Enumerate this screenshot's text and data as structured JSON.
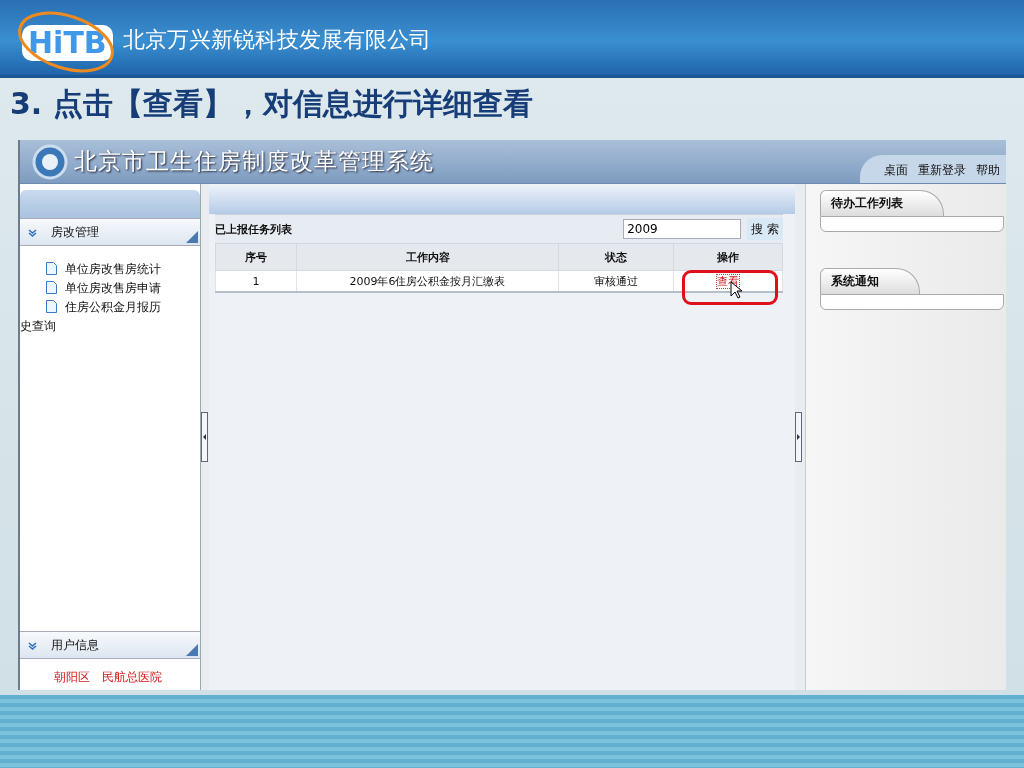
{
  "company": {
    "logo": "HiTB",
    "name": "北京万兴新锐科技发展有限公司"
  },
  "slide_title": "3. 点击【查看】，对信息进行详细查看",
  "app": {
    "title": "北京市卫生住房制度改革管理系统",
    "nav_links": [
      "桌面",
      "重新登录",
      "帮助"
    ]
  },
  "sidebar": {
    "sections": [
      {
        "title": "房改管理",
        "expanded": true,
        "items": [
          "单位房改售房统计",
          "单位房改售房申请",
          "住房公积金月报历史查询"
        ]
      },
      {
        "title": "用户信息",
        "expanded": true,
        "info": [
          "朝阳区",
          "民航总医院"
        ]
      }
    ]
  },
  "task_list": {
    "title": "已上报任务列表",
    "search_value": "2009",
    "search_button": "搜 索",
    "columns": [
      "序号",
      "工作内容",
      "状态",
      "操作"
    ],
    "rows": [
      {
        "index": "1",
        "content": "2009年6住房公积金按月汇缴表",
        "status": "审核通过",
        "action": "查看",
        "highlighted": true
      }
    ]
  },
  "right_panel": {
    "tabs": [
      "待办工作列表",
      "系统通知"
    ]
  }
}
